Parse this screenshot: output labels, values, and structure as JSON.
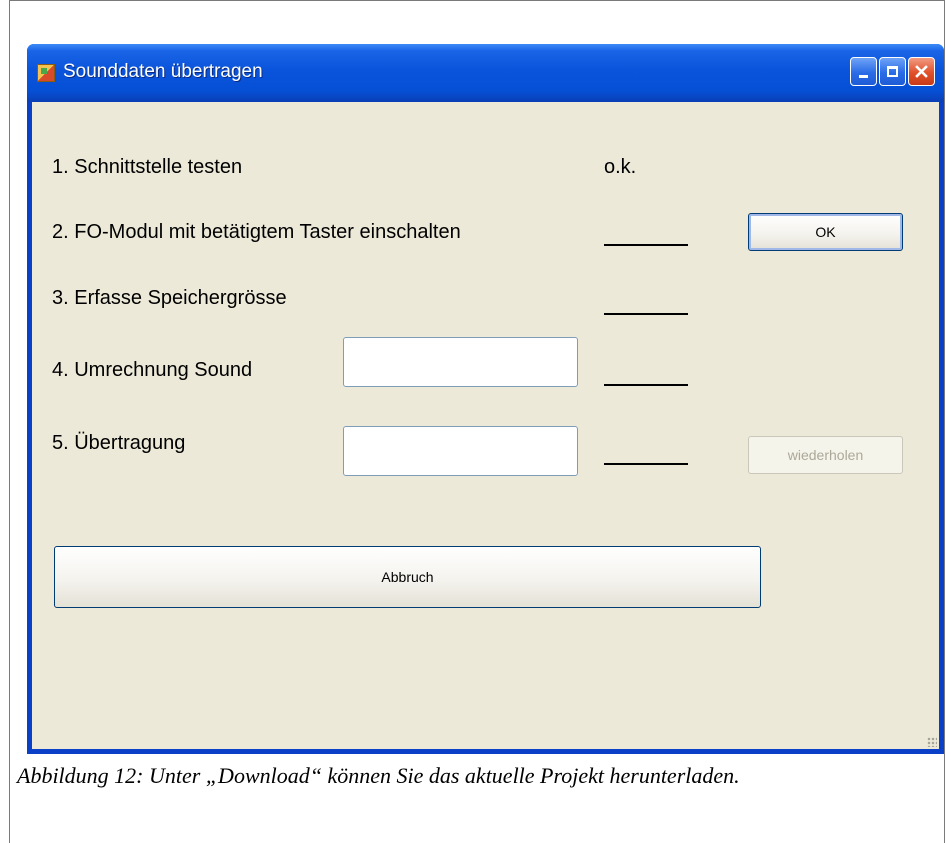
{
  "window": {
    "title": "Sounddaten übertragen",
    "app_icon": "application-icon",
    "controls": [
      "minimize-icon",
      "maximize-icon",
      "close-icon"
    ]
  },
  "steps": [
    {
      "label": "1. Schnittstelle testen",
      "status": "o.k."
    },
    {
      "label": "2. FO-Modul mit betätigtem Taster einschalten",
      "status": ""
    },
    {
      "label": "3. Erfasse Speichergrösse",
      "status": ""
    },
    {
      "label": "4. Umrechnung Sound",
      "status": ""
    },
    {
      "label": "5. Übertragung",
      "status": ""
    }
  ],
  "fields": {
    "umrechnung_value": "",
    "uebertragung_value": ""
  },
  "buttons": {
    "ok": "OK",
    "wiederholen": "wiederholen",
    "abbruch": "Abbruch"
  },
  "caption": "Abbildung 12: Unter „Download“ können Sie das aktuelle Projekt herunterladen.",
  "colors": {
    "titlebar": "#0a54dc",
    "client_background": "#ece9d8",
    "close_button": "#e0502a"
  }
}
